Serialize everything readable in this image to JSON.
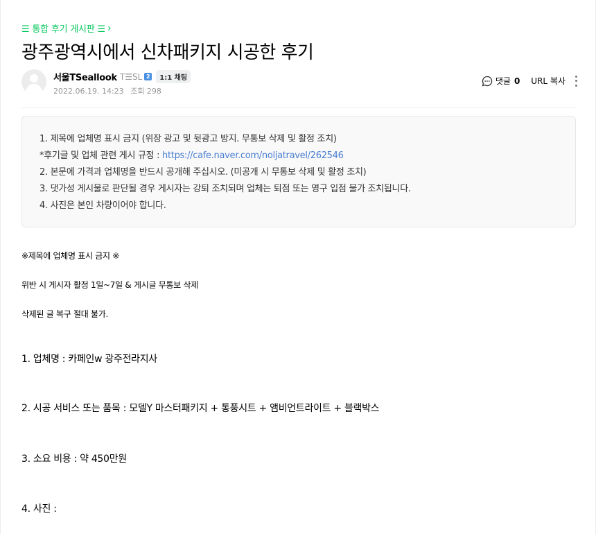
{
  "board": {
    "link_label": "☰ 통합 후기 게시판 ☰",
    "chevron": "›"
  },
  "post": {
    "title": "광주광역시에서 신차패키지 시공한 후기",
    "author": {
      "nickname": "서울TSeallook",
      "grade": "T☰SL",
      "grade_badge": "2",
      "chat_label": "1:1 채팅"
    },
    "date": "2022.06.19. 14:23",
    "views_label": "조회 298"
  },
  "tools": {
    "comment_label": "댓글",
    "comment_count": "0",
    "url_copy": "URL 복사",
    "icons": [
      "comment-icon",
      "more-icon"
    ]
  },
  "notice": {
    "line1": "1. 제목에 업체명 표시 금지 (위장 광고 및 뒷광고 방지. 무통보 삭제 및 활정 조치)",
    "line2_prefix": "*후기글 및 업체 관련 게시 규정 : ",
    "line2_link": "https://cafe.naver.com/noljatravel/262546",
    "line3": "2. 본문에 가격과 업체명을 반드시 공개해 주십시오. (미공개 시 무통보 삭제 및 활정 조치)",
    "line4": "3. 댓가성 게시물로 판단될 경우 게시자는 강퇴 조치되며 업체는 퇴점 또는 영구 입점 불가 조치됩니다.",
    "line5": "4. 사진은 본인 차량이어야 합니다."
  },
  "content": {
    "warning_title": "※제목에 업체명 표시 금지 ※",
    "warning_penalty": "위반 시 게시자 활정 1일~7일 & 게시글 무통보 삭제",
    "warning_restore": "삭제된 글 복구 절대 불가.",
    "item1": "1. 업체명 : 카페인w 광주전라지사",
    "item2": "2. 시공 서비스 또는 품목 : 모델Y 마스터패키지 + 통풍시트 + 앰비언트라이트 + 블랙박스",
    "item3": "3. 소요 비용 : 약 450만원",
    "item4": "4. 사진 :"
  },
  "colors": {
    "accent_green": "#03c75a",
    "link_blue": "#4a7fd0",
    "muted_gray": "#979797"
  }
}
